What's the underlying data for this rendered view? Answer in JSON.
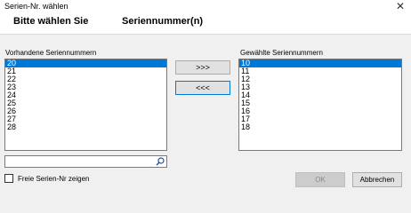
{
  "window": {
    "title": "Serien-Nr. wählen",
    "close_glyph": "✕"
  },
  "header": {
    "choose_label": "Bitte wählen Sie",
    "serial_label": "Seriennummer(n)"
  },
  "available": {
    "label": "Vorhandene Seriennummern",
    "items": [
      "20",
      "21",
      "22",
      "23",
      "24",
      "25",
      "26",
      "27",
      "28"
    ],
    "selected_index": 0
  },
  "chosen": {
    "label": "Gewählte Seriennummern",
    "items": [
      "10",
      "11",
      "12",
      "13",
      "14",
      "15",
      "16",
      "17",
      "18"
    ],
    "selected_index": 0
  },
  "buttons": {
    "add_all": ">>>",
    "remove_all": "<<<",
    "ok": "OK",
    "cancel": "Abbrechen"
  },
  "search": {
    "value": "",
    "icon": "search-icon"
  },
  "free_serials": {
    "label": "Freie Serien-Nr zeigen",
    "checked": false
  },
  "colors": {
    "selection": "#0078d7",
    "background": "#f0f0f0"
  }
}
